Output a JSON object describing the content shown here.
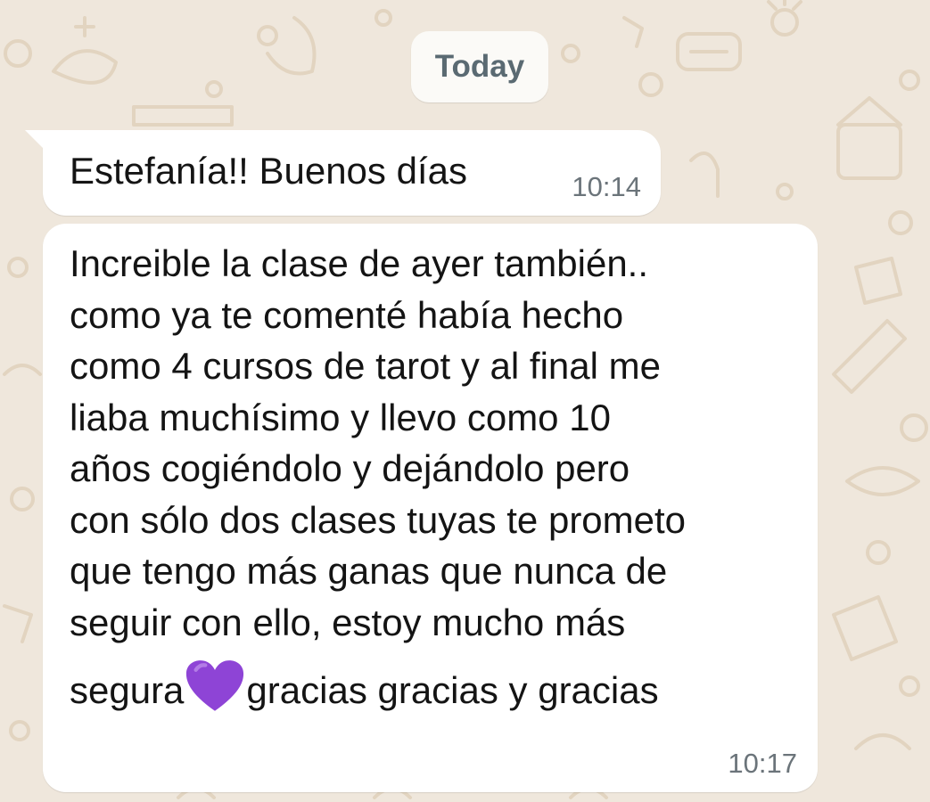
{
  "date_separator": "Today",
  "messages": [
    {
      "text": "Estefanía!! Buenos días",
      "time": "10:14"
    },
    {
      "lines": [
        "Increible la clase de ayer también..",
        "como ya te comenté había hecho",
        "como 4 cursos de tarot y al final me",
        "liaba muchísimo y llevo como 10",
        "años cogiéndolo y dejándolo pero",
        "con sólo dos clases tuyas te prometo",
        "que tengo más ganas que nunca de",
        "seguir con ello, estoy mucho más"
      ],
      "last_line_before": "segura",
      "emoji": "purple-heart-icon",
      "last_line_after": "gracias gracias y gracias",
      "time": "10:17"
    }
  ],
  "colors": {
    "wallpaper": "#efe7dc",
    "doodle": "#e2d4c0",
    "bubble": "#ffffff",
    "text": "#141414",
    "timestamp": "#6b747a",
    "heart": "#8e44d6"
  }
}
